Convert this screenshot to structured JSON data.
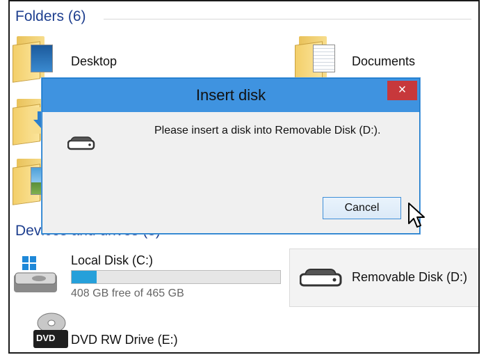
{
  "groups": {
    "folders_header": "Folders (6)",
    "devices_header": "Devices and drives (3)"
  },
  "folders": [
    {
      "name": "Desktop",
      "icon": "desktop-folder-icon"
    },
    {
      "name": "Documents",
      "icon": "documents-folder-icon"
    },
    {
      "name": "",
      "icon": "downloads-folder-icon"
    },
    {
      "name": "",
      "icon": "pictures-folder-icon"
    }
  ],
  "drives": {
    "local_disk": {
      "name": "Local Disk (C:)",
      "free_text": "408 GB free of 465 GB",
      "used_fraction": 0.12
    },
    "removable": {
      "name": "Removable Disk (D:)"
    },
    "dvd": {
      "name": "DVD RW Drive (E:)",
      "icon_text": "DVD"
    }
  },
  "dialog": {
    "title": "Insert disk",
    "message": "Please insert a disk into Removable Disk (D:).",
    "cancel_label": "Cancel",
    "close_glyph": "×"
  },
  "colors": {
    "accent_blue": "#3f93e0",
    "close_red": "#c7383b",
    "header_blue": "#1e3f8f",
    "bar_fill": "#26a0da"
  }
}
